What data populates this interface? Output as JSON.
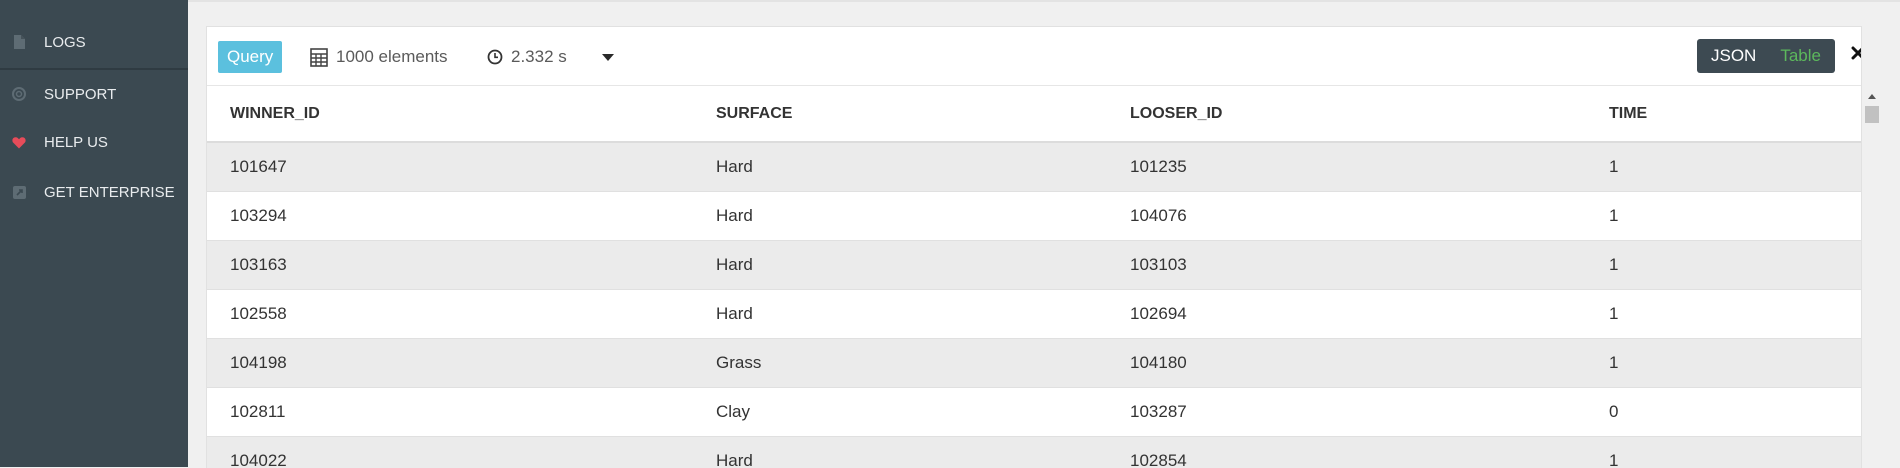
{
  "sidebar": {
    "items": [
      {
        "label": "LOGS",
        "icon": "document-icon"
      },
      {
        "label": "SUPPORT",
        "icon": "lifebuoy-icon"
      },
      {
        "label": "HELP US",
        "icon": "heart-icon"
      },
      {
        "label": "GET ENTERPRISE",
        "icon": "external-link-icon"
      }
    ]
  },
  "toolbar": {
    "query_label": "Query",
    "elements_label": "1000 elements",
    "time_label": "2.332 s",
    "json_label": "JSON",
    "table_label": "Table"
  },
  "table": {
    "columns": [
      "WINNER_ID",
      "SURFACE",
      "LOOSER_ID",
      "TIME"
    ],
    "rows": [
      [
        "101647",
        "Hard",
        "101235",
        "1"
      ],
      [
        "103294",
        "Hard",
        "104076",
        "1"
      ],
      [
        "103163",
        "Hard",
        "103103",
        "1"
      ],
      [
        "102558",
        "Hard",
        "102694",
        "1"
      ],
      [
        "104198",
        "Grass",
        "104180",
        "1"
      ],
      [
        "102811",
        "Clay",
        "103287",
        "0"
      ],
      [
        "104022",
        "Hard",
        "102854",
        "1"
      ]
    ]
  },
  "colors": {
    "sidebar_bg": "#3b4951",
    "query_accent": "#5bc0de",
    "table_active": "#5cb85c",
    "heart": "#e74c5a"
  }
}
